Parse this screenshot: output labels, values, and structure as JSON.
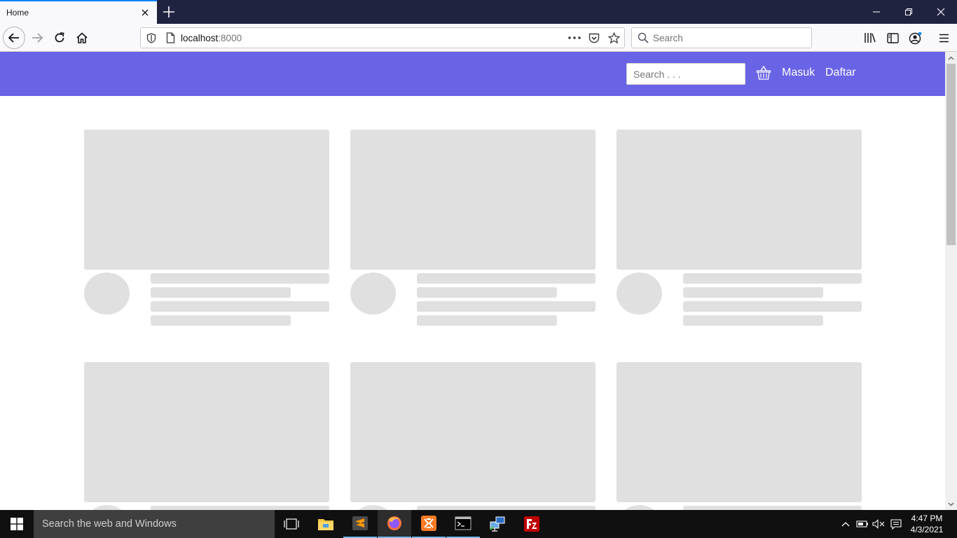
{
  "browser": {
    "tab": {
      "title": "Home"
    },
    "url": {
      "host": "localhost",
      "port": ":8000"
    },
    "search_placeholder": "Search"
  },
  "site": {
    "header_color": "#6963e6",
    "search_placeholder": "Search . . .",
    "nav": {
      "login": "Masuk",
      "register": "Daftar"
    },
    "skeleton_cards": 6
  },
  "taskbar": {
    "search_placeholder": "Search the web and Windows",
    "apps": [
      "task-view",
      "file-explorer",
      "sublime-text",
      "firefox",
      "xampp",
      "command-prompt",
      "network-tool",
      "filezilla"
    ],
    "time": "4:47 PM",
    "date": "4/3/2021"
  }
}
